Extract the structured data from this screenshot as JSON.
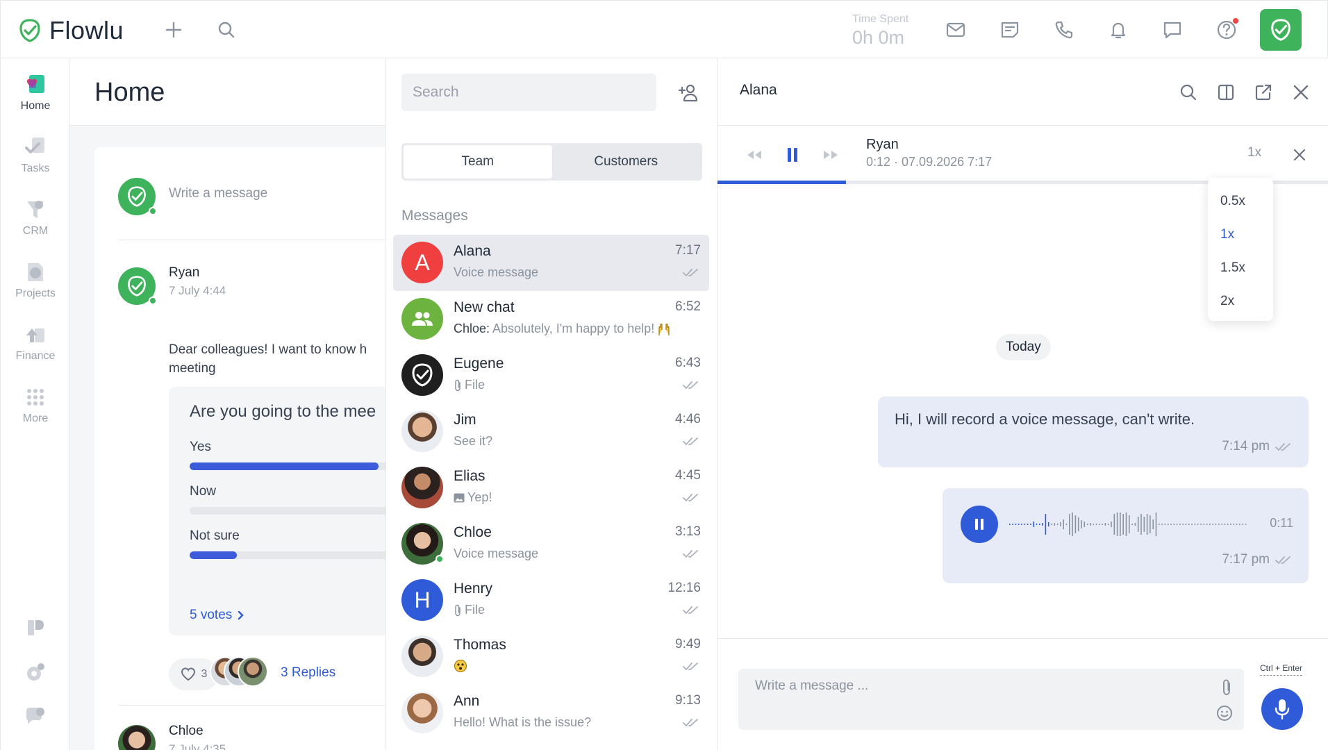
{
  "app": {
    "name": "Flowlu"
  },
  "topbar": {
    "time_spent_label": "Time Spent",
    "time_spent_value": "0h 0m",
    "icons": [
      "plus-icon",
      "search-icon",
      "mail-icon",
      "notes-icon",
      "phone-icon",
      "bell-icon",
      "chat-icon",
      "help-icon",
      "flowlu-check-icon"
    ]
  },
  "nav": {
    "items": [
      {
        "label": "Home",
        "icon": "home-icon",
        "active": true
      },
      {
        "label": "Tasks",
        "icon": "tasks-icon"
      },
      {
        "label": "CRM",
        "icon": "crm-icon"
      },
      {
        "label": "Projects",
        "icon": "projects-icon"
      },
      {
        "label": "Finance",
        "icon": "finance-icon"
      },
      {
        "label": "More",
        "icon": "more-icon"
      }
    ]
  },
  "home": {
    "title": "Home",
    "write_placeholder": "Write a message",
    "post": {
      "author": "Ryan",
      "date": "7 July 4:44",
      "text": "Dear colleagues! I want to know h meeting",
      "poll": {
        "question": "Are you going to the mee",
        "options": [
          {
            "label": "Yes",
            "percent": 80
          },
          {
            "label": "Now",
            "percent": 0
          },
          {
            "label": "Not sure",
            "percent": 20
          }
        ],
        "votes": "5 votes"
      },
      "likes": "3",
      "replies": "3 Replies"
    },
    "next_post": {
      "author": "Chloe",
      "date": "7 July 4:35"
    }
  },
  "chatlist": {
    "search_placeholder": "Search",
    "tabs": [
      {
        "label": "Team",
        "active": true
      },
      {
        "label": "Customers"
      }
    ],
    "section_label": "Messages",
    "chats": [
      {
        "name": "Alana",
        "time": "7:17",
        "preview": "Voice message",
        "active": true
      },
      {
        "name": "New chat",
        "time": "6:52",
        "preview_author": "Chloe:",
        "preview": "Absolutely, I'm happy to help!"
      },
      {
        "name": "Eugene",
        "time": "6:43",
        "preview": "File"
      },
      {
        "name": "Jim",
        "time": "4:46",
        "preview": "See it?"
      },
      {
        "name": "Elias",
        "time": "4:45",
        "preview": "Yep!"
      },
      {
        "name": "Chloe",
        "time": "3:13",
        "preview": "Voice message"
      },
      {
        "name": "Henry",
        "time": "12:16",
        "preview": "File"
      },
      {
        "name": "Thomas",
        "time": "9:49",
        "preview": ""
      },
      {
        "name": "Ann",
        "time": "9:13",
        "preview": "Hello! What is the issue?"
      }
    ],
    "avatar_letters": {
      "alana": "A",
      "henry": "H"
    }
  },
  "conversation": {
    "title": "Alana",
    "player": {
      "name": "Ryan",
      "meta": "0:12 · 07.09.2026 7:17",
      "speed": "1x",
      "progress": 0.21,
      "speed_options": [
        "0.5x",
        "1x",
        "1.5x",
        "2x"
      ],
      "selected_speed": "1x"
    },
    "date_divider": "Today",
    "messages": [
      {
        "text": "Hi, I will record a voice message, can't write.",
        "time": "7:14 pm"
      },
      {
        "type": "voice",
        "duration": "0:11",
        "time": "7:17 pm"
      }
    ],
    "composer_placeholder": "Write a message ...",
    "shortcut_hint": "Ctrl + Enter"
  },
  "colors": {
    "brand_green": "#3eb35b",
    "accent_blue": "#2f5bd9",
    "bubble_bg": "#e7ebf7",
    "avatar_red": "#ef3f3f",
    "avatar_blue": "#2f5bd9"
  }
}
